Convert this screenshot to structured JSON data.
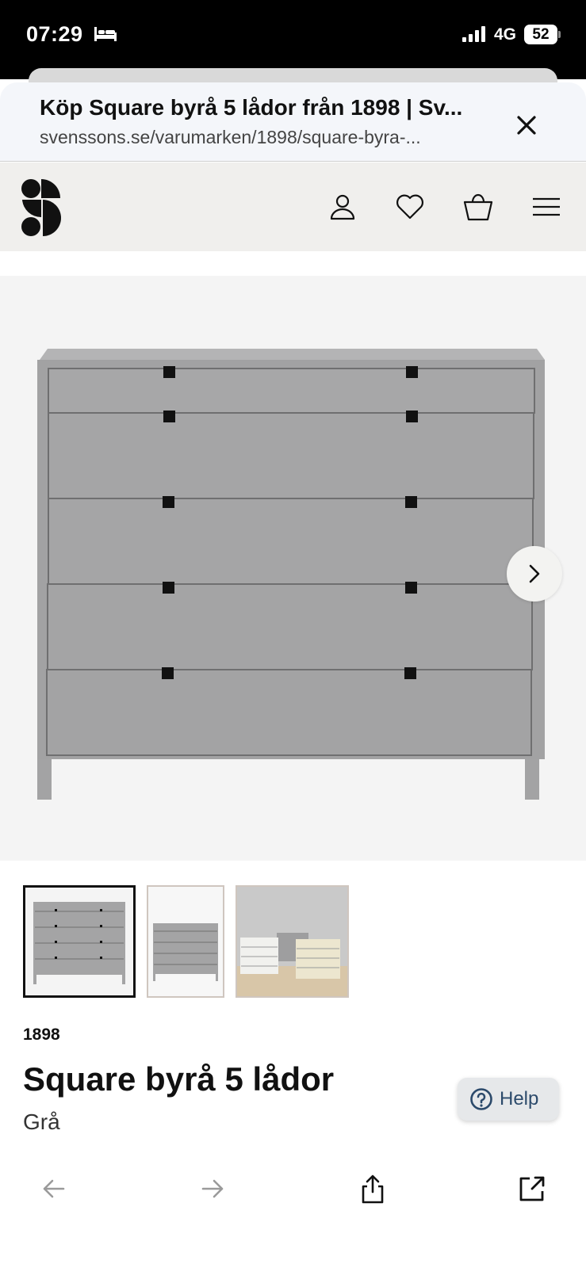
{
  "status_bar": {
    "time": "07:29",
    "network": "4G",
    "battery": "52"
  },
  "browser": {
    "page_title": "Köp Square byrå 5 lådor från 1898 | Sv...",
    "url": "svenssons.se/varumarken/1898/square-byra-..."
  },
  "site_header": {
    "icons": [
      "account-icon",
      "heart-icon",
      "basket-icon",
      "menu-icon"
    ]
  },
  "gallery": {
    "thumbnails": [
      "thumbnail-1",
      "thumbnail-2",
      "thumbnail-3"
    ],
    "selected_index": 0
  },
  "product": {
    "brand": "1898",
    "title": "Square byrå 5 lådor",
    "variant": "Grå"
  },
  "help": {
    "label": "Help"
  },
  "toolbar": {
    "icons": [
      "back-arrow-icon",
      "forward-arrow-icon",
      "share-icon",
      "open-external-icon"
    ]
  },
  "colors": {
    "header_bg": "#f0efed",
    "dresser_gray": "#9e9e9f",
    "accent_help": "#2c4a6b"
  }
}
